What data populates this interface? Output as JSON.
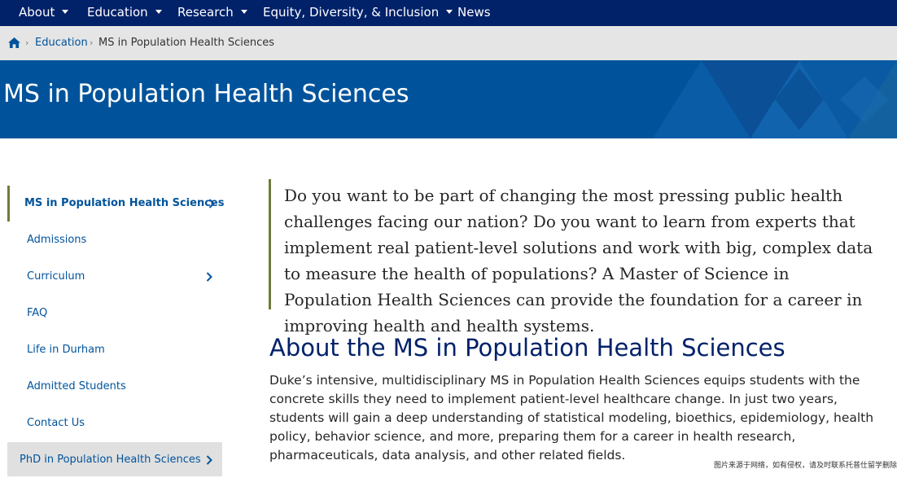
{
  "nav": {
    "items": [
      {
        "label": "About",
        "dropdown": true
      },
      {
        "label": "Education",
        "dropdown": true
      },
      {
        "label": "Research",
        "dropdown": true
      },
      {
        "label": "Equity, Diversity, & Inclusion",
        "dropdown": true
      },
      {
        "label": "News",
        "dropdown": false
      }
    ]
  },
  "breadcrumb": {
    "home_icon": "home-icon",
    "items": [
      "Education",
      "MS in Population Health Sciences"
    ]
  },
  "page": {
    "title": "MS in Population Health Sciences"
  },
  "sidebar": {
    "items": [
      {
        "label": "MS in Population Health Sciences",
        "has_children": true,
        "active": true
      },
      {
        "label": "Admissions",
        "has_children": false
      },
      {
        "label": "Curriculum",
        "has_children": true
      },
      {
        "label": "FAQ",
        "has_children": false
      },
      {
        "label": "Life in Durham",
        "has_children": false
      },
      {
        "label": "Admitted Students",
        "has_children": false
      },
      {
        "label": "Contact Us",
        "has_children": false
      },
      {
        "label": "PhD in Population Health Sciences",
        "has_children": true
      }
    ]
  },
  "intro": {
    "quote": "Do you want to be part of changing the most pressing public health challenges facing our nation? Do you want to learn from experts that implement real patient-level solutions and work with big, complex data to measure the health of populations? A Master of Science in Population Health Sciences can provide the foundation for a career in improving health and health systems."
  },
  "about": {
    "heading": "About the MS in Population Health Sciences",
    "body": "Duke’s intensive, multidisciplinary MS in Population Health Sciences equips students with the concrete skills they need to implement patient-level healthcare change. In just two years, students will gain a deep understanding of statistical modeling, bioethics, epidemiology, health policy, behavior science, and more, preparing them for a career in health research, pharmaceuticals, data analysis, and other related fields."
  },
  "watermark": "图片来源于网络，如有侵权，请及时联系托普仕留学删除",
  "colors": {
    "nav_bg": "#012169",
    "hero_bg": "#00539b",
    "link": "#00539b",
    "accent_bar": "#6d7c3a",
    "breadcrumb_bg": "#e5e5e5"
  }
}
